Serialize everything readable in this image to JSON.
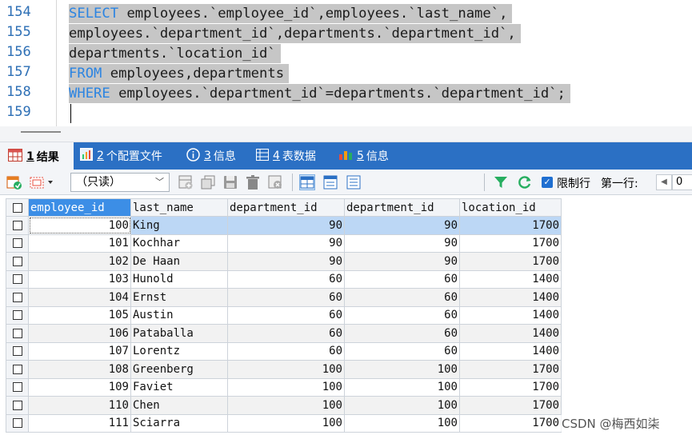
{
  "editor": {
    "line_numbers": [
      "154",
      "155",
      "156",
      "157",
      "158",
      "159"
    ],
    "lines": [
      {
        "kw": "SELECT",
        "text": " employees.`employee_id`,employees.`last_name`,"
      },
      {
        "kw": "",
        "text": "employees.`department_id`,departments.`department_id`,"
      },
      {
        "kw": "",
        "text": "departments.`location_id`"
      },
      {
        "kw": "FROM",
        "text": " employees,departments"
      },
      {
        "kw": "WHERE",
        "text": " employees.`department_id`=departments.`department_id`;"
      }
    ]
  },
  "tabs": [
    {
      "num": "1",
      "label": "结果"
    },
    {
      "num": "2",
      "label": "个配置文件"
    },
    {
      "num": "3",
      "label": "信息"
    },
    {
      "num": "4",
      "label": "表数据"
    },
    {
      "num": "5",
      "label": "信息"
    }
  ],
  "toolbar": {
    "mode_select": "（只读）",
    "limit_label": "限制行",
    "first_row_label": "第一行:",
    "first_row_value": "0"
  },
  "grid": {
    "columns": [
      "employee_id",
      "last_name",
      "department_id",
      "department_id",
      "location_id"
    ],
    "rows": [
      [
        "100",
        "King",
        "90",
        "90",
        "1700"
      ],
      [
        "101",
        "Kochhar",
        "90",
        "90",
        "1700"
      ],
      [
        "102",
        "De Haan",
        "90",
        "90",
        "1700"
      ],
      [
        "103",
        "Hunold",
        "60",
        "60",
        "1400"
      ],
      [
        "104",
        "Ernst",
        "60",
        "60",
        "1400"
      ],
      [
        "105",
        "Austin",
        "60",
        "60",
        "1400"
      ],
      [
        "106",
        "Pataballa",
        "60",
        "60",
        "1400"
      ],
      [
        "107",
        "Lorentz",
        "60",
        "60",
        "1400"
      ],
      [
        "108",
        "Greenberg",
        "100",
        "100",
        "1700"
      ],
      [
        "109",
        "Faviet",
        "100",
        "100",
        "1700"
      ],
      [
        "110",
        "Chen",
        "100",
        "100",
        "1700"
      ],
      [
        "111",
        "Sciarra",
        "100",
        "100",
        "1700"
      ]
    ]
  },
  "watermark": "CSDN @梅西如柒",
  "colors": {
    "keyword": "#2b84e2",
    "tabbar": "#2b70c4",
    "selection": "#c6c6c6",
    "header_selected": "#3c8ee6"
  }
}
